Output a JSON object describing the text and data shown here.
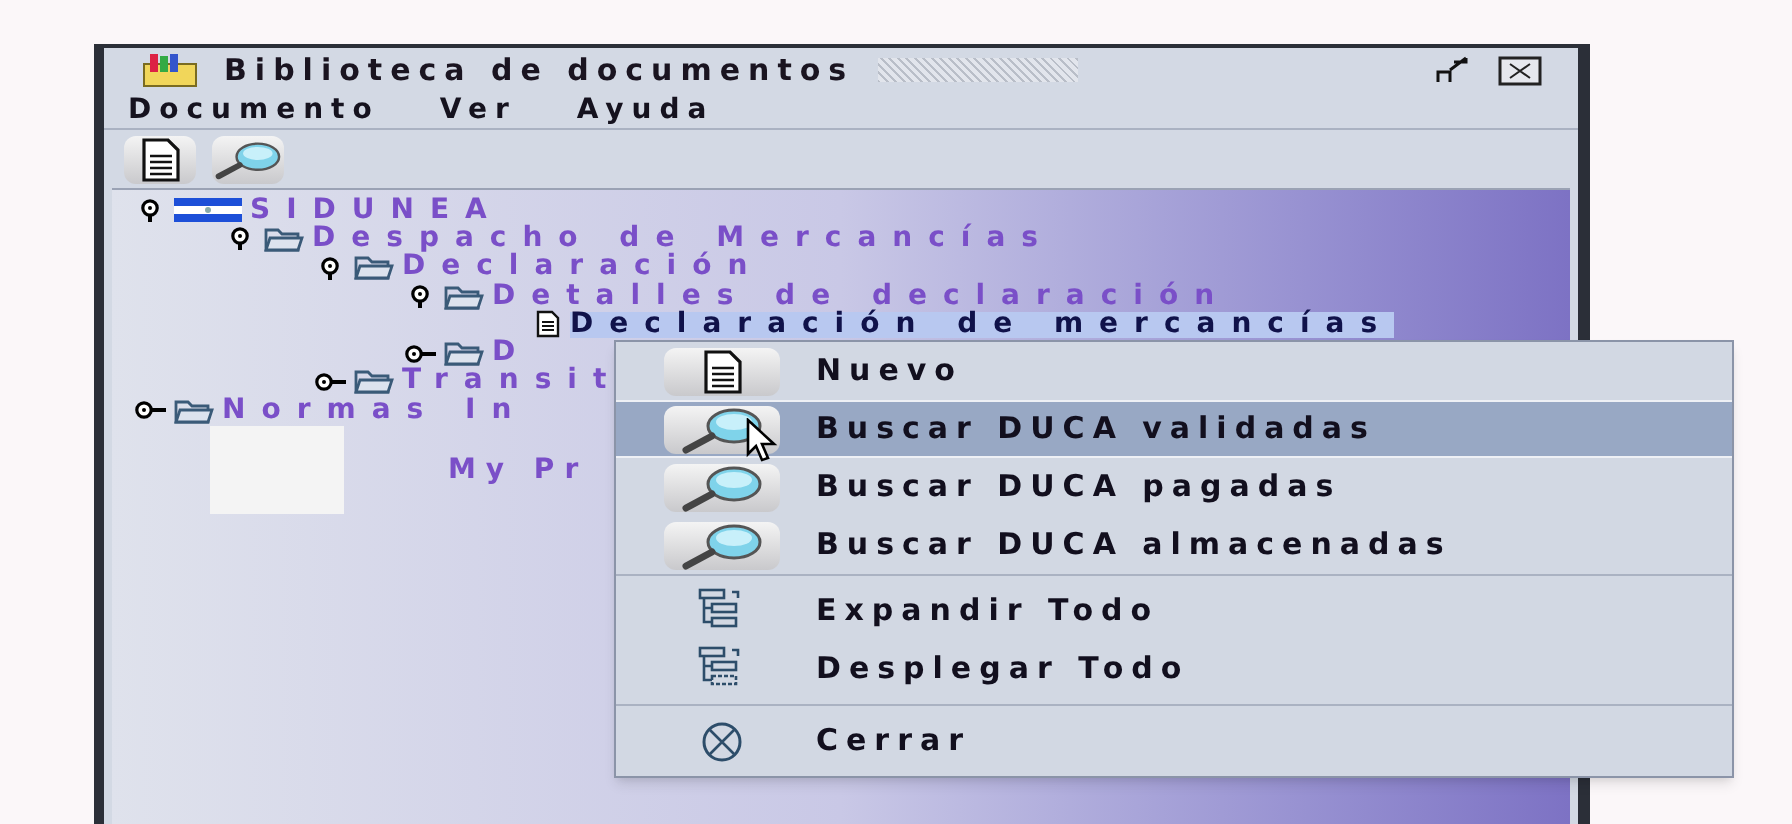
{
  "window": {
    "title": "Biblioteca de documentos"
  },
  "menu_bar": [
    "Documento",
    "Ver",
    "Ayuda"
  ],
  "toolbar": [
    {
      "kind": "document"
    },
    {
      "kind": "search"
    }
  ],
  "tree": [
    {
      "label": "SIDUNEA",
      "kind": "flag",
      "expanded": true,
      "selected": false,
      "children": [
        {
          "label": "Despacho de Mercancías",
          "kind": "folder",
          "expanded": true,
          "selected": false,
          "children": [
            {
              "label": "Declaración",
              "kind": "folder",
              "expanded": true,
              "selected": false,
              "children": [
                {
                  "label": "Detalles de declaración",
                  "kind": "folder",
                  "expanded": true,
                  "selected": false,
                  "children": [
                    {
                      "label": "Declaración de mercancías",
                      "kind": "document",
                      "selected": true
                    }
                  ]
                },
                {
                  "label": "D",
                  "kind": "folder",
                  "expanded": false,
                  "selected": false
                }
              ]
            },
            {
              "label": "Transit",
              "kind": "folder",
              "expanded": false,
              "selected": false
            }
          ]
        }
      ]
    },
    {
      "label": "Normas In",
      "kind": "folder",
      "expanded": false,
      "selected": false
    }
  ],
  "profile": {
    "label": "My Pr"
  },
  "context_menu": {
    "sections": [
      [
        {
          "label": "Nuevo",
          "kind": "document",
          "selected": false
        },
        {
          "label": "Buscar DUCA validadas",
          "kind": "search",
          "selected": true
        },
        {
          "label": "Buscar DUCA pagadas",
          "kind": "search",
          "selected": false
        },
        {
          "label": "Buscar DUCA almacenadas",
          "kind": "search",
          "selected": false
        }
      ],
      [
        {
          "label": "Expandir Todo",
          "kind": "expand",
          "selected": false
        },
        {
          "label": "Desplegar Todo",
          "kind": "collapse",
          "selected": false
        }
      ],
      [
        {
          "label": "Cerrar",
          "kind": "close",
          "selected": false
        }
      ]
    ]
  }
}
